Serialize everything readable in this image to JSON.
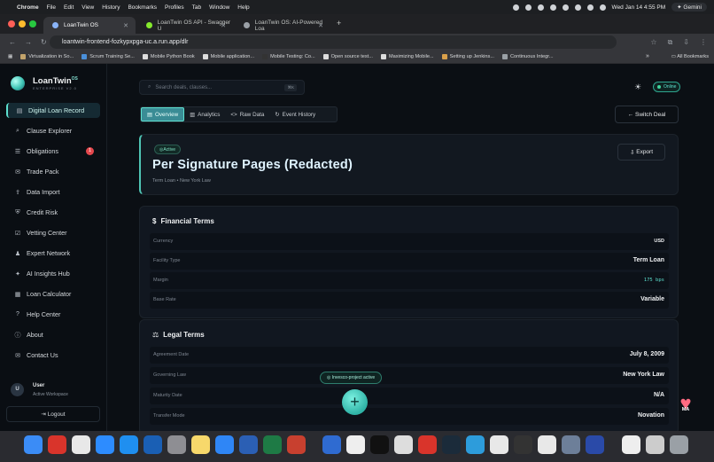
{
  "menubar": {
    "apple": "",
    "app": "Chrome",
    "menus": [
      "File",
      "Edit",
      "View",
      "History",
      "Bookmarks",
      "Profiles",
      "Tab",
      "Window",
      "Help"
    ],
    "clock": "Wed Jan 14  4:55 PM",
    "gemini": "Gemini"
  },
  "browser": {
    "tabs": [
      {
        "title": "LoanTwin OS"
      },
      {
        "title": "LoanTwin OS API - Swagger U"
      },
      {
        "title": "LoanTwin OS: AI-Powered Loa"
      }
    ],
    "new_tab": "+",
    "url": "loantwin-frontend-fozkypxpga-uc.a.run.app/dlr",
    "bookmarks": [
      "Virtualization in So...",
      "Scrum Training Se...",
      "Mobile Python Book",
      "Mobile application...",
      "Mobile Testing: Co...",
      "Open source test...",
      "Maximizing Mobile...",
      "Setting up Jenkins...",
      "Continuous Integr..."
    ],
    "more_bookmarks": "»",
    "all_bookmarks": "All Bookmarks"
  },
  "sidebar": {
    "brand": "LoanTwin",
    "brand_sup": "OS",
    "brand_sub": "ENTERPRISE V2.0",
    "items": [
      {
        "label": "Digital Loan Record",
        "icon": "▤"
      },
      {
        "label": "Clause Explorer",
        "icon": "⌕"
      },
      {
        "label": "Obligations",
        "icon": "☰",
        "badge": "1"
      },
      {
        "label": "Trade Pack",
        "icon": "✉"
      },
      {
        "label": "Data Import",
        "icon": "⇪"
      },
      {
        "label": "Credit Risk",
        "icon": "⛨"
      },
      {
        "label": "Vetting Center",
        "icon": "☑"
      },
      {
        "label": "Expert Network",
        "icon": "♟"
      },
      {
        "label": "AI Insights Hub",
        "icon": "✦"
      },
      {
        "label": "Loan Calculator",
        "icon": "▦"
      },
      {
        "label": "Help Center",
        "icon": "?"
      },
      {
        "label": "About",
        "icon": "ⓘ"
      },
      {
        "label": "Contact Us",
        "icon": "✉"
      }
    ],
    "user": {
      "initial": "U",
      "name": "User",
      "workspace": "Active Workspace"
    },
    "logout": "Logout"
  },
  "topbar": {
    "search_placeholder": "Search deals, clauses...",
    "search_kbd": "⌘K",
    "online": "Online"
  },
  "view_tabs": [
    {
      "label": "Overview",
      "icon": "▤"
    },
    {
      "label": "Analytics",
      "icon": "▥"
    },
    {
      "label": "Raw Data",
      "icon": "<>"
    },
    {
      "label": "Event History",
      "icon": "↻"
    }
  ],
  "switch_deal": "Switch Deal",
  "deal": {
    "status": "Active",
    "title": "Per Signature Pages (Redacted)",
    "subtitle": "Term Loan • New York Law",
    "export": "Export"
  },
  "financial": {
    "title": "Financial Terms",
    "icon": "$",
    "rows": [
      {
        "label": "Currency",
        "value": "USD"
      },
      {
        "label": "Facility Type",
        "value": "Term Loan"
      },
      {
        "label": "Margin",
        "value": "175 bps"
      },
      {
        "label": "Base Rate",
        "value": "Variable"
      }
    ]
  },
  "legal": {
    "title": "Legal Terms",
    "icon": "⚖",
    "rows": [
      {
        "label": "Agreement Date",
        "value": "July 8, 2009"
      },
      {
        "label": "Governing Law",
        "value": "New York Law"
      },
      {
        "label": "Maturity Date",
        "value": "N/A"
      },
      {
        "label": "Transfer Mode",
        "value": "Novation"
      }
    ]
  },
  "toast": "Invesco-project active",
  "fab": "+",
  "heart_badge": "MA"
}
